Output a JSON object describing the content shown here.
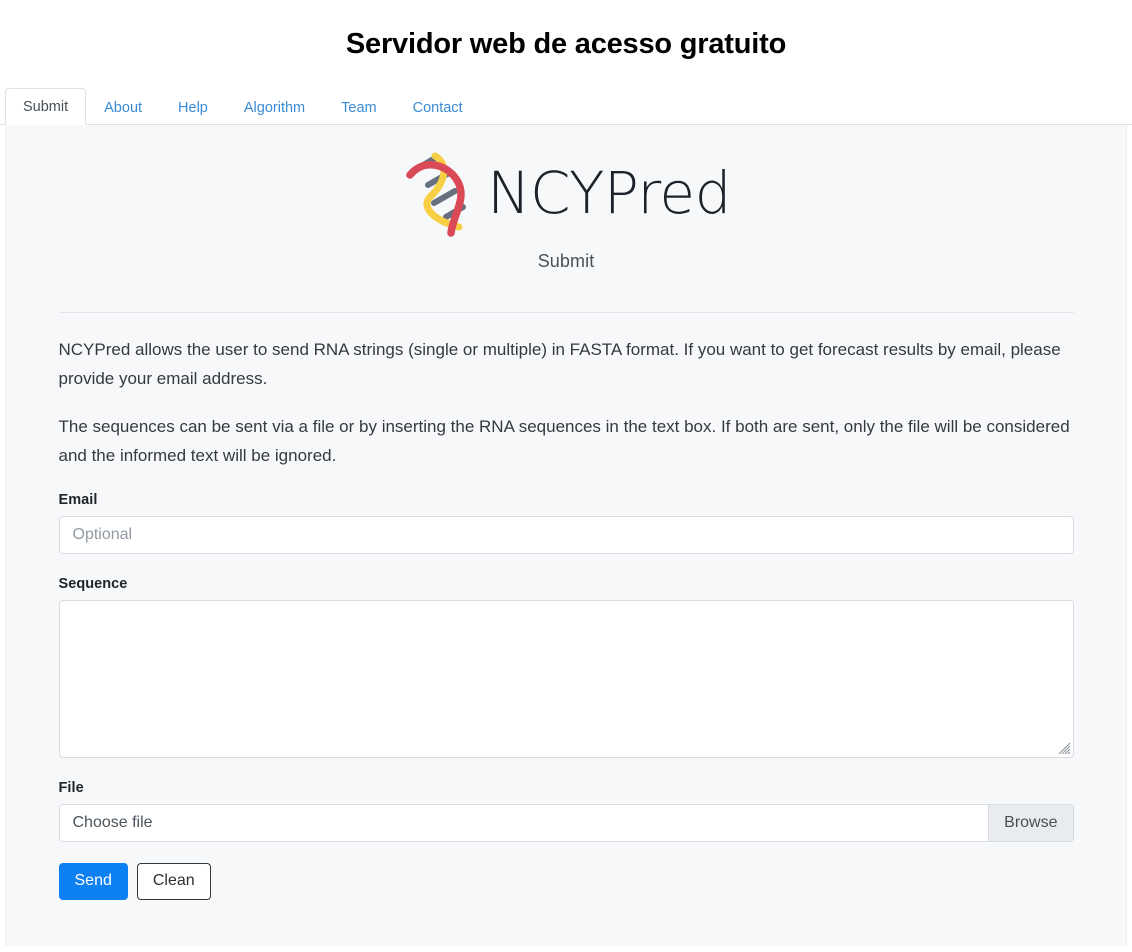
{
  "header": {
    "title": "Servidor web de acesso gratuito"
  },
  "tabs": [
    {
      "label": "Submit",
      "active": true
    },
    {
      "label": "About",
      "active": false
    },
    {
      "label": "Help",
      "active": false
    },
    {
      "label": "Algorithm",
      "active": false
    },
    {
      "label": "Team",
      "active": false
    },
    {
      "label": "Contact",
      "active": false
    }
  ],
  "brand": {
    "name": "NCYPred",
    "subtitle": "Submit",
    "logo_icon": "rna-helix-icon"
  },
  "intro": {
    "paragraph1": "NCYPred allows the user to send RNA strings (single or multiple) in FASTA format. If you want to get forecast results by email, please provide your email address.",
    "paragraph2": "The sequences can be sent via a file or by inserting the RNA sequences in the text box. If both are sent, only the file will be considered and the informed text will be ignored."
  },
  "form": {
    "email": {
      "label": "Email",
      "placeholder": "Optional",
      "value": ""
    },
    "sequence": {
      "label": "Sequence",
      "placeholder": "",
      "value": ""
    },
    "file": {
      "label": "File",
      "chooser_text": "Choose file",
      "browse_label": "Browse"
    },
    "buttons": {
      "send_label": "Send",
      "clean_label": "Clean"
    }
  },
  "colors": {
    "accent_blue": "#0d80f2",
    "link_blue": "#3a8bd6",
    "panel_bg": "#f7f8fa",
    "helix_red": "#d94a56",
    "helix_yellow": "#f7cf45",
    "helix_rung": "#66707e"
  }
}
